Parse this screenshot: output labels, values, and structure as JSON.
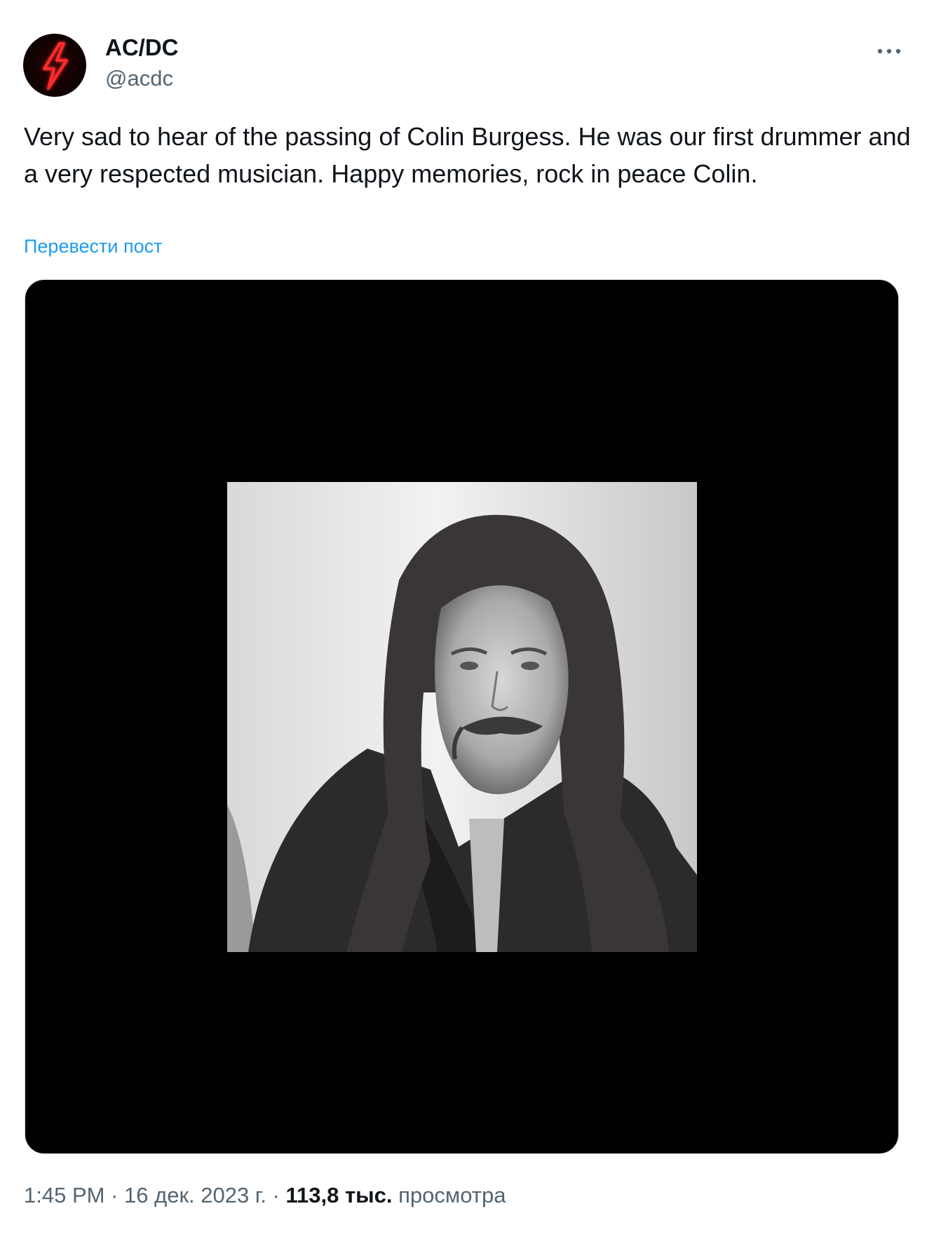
{
  "author": {
    "display_name": "AC/DC",
    "handle": "@acdc",
    "avatar_icon": "lightning-bolt-icon",
    "avatar_accent": "#e01010"
  },
  "post": {
    "text": "Very sad to hear of the passing of Colin Burgess. He was our first drummer and a very respected musician. Happy memories, rock in peace Colin.",
    "translate_label": "Перевести пост"
  },
  "meta": {
    "time": "1:45 PM",
    "separator": " · ",
    "date": "16 дек. 2023 г.",
    "views_count": "113,8 тыс.",
    "views_label": "просмотра"
  },
  "menu": {
    "icon": "more-options-icon"
  },
  "colors": {
    "text": "#0f1419",
    "secondary": "#536471",
    "link": "#1d9bf0",
    "media_background": "#000000"
  }
}
